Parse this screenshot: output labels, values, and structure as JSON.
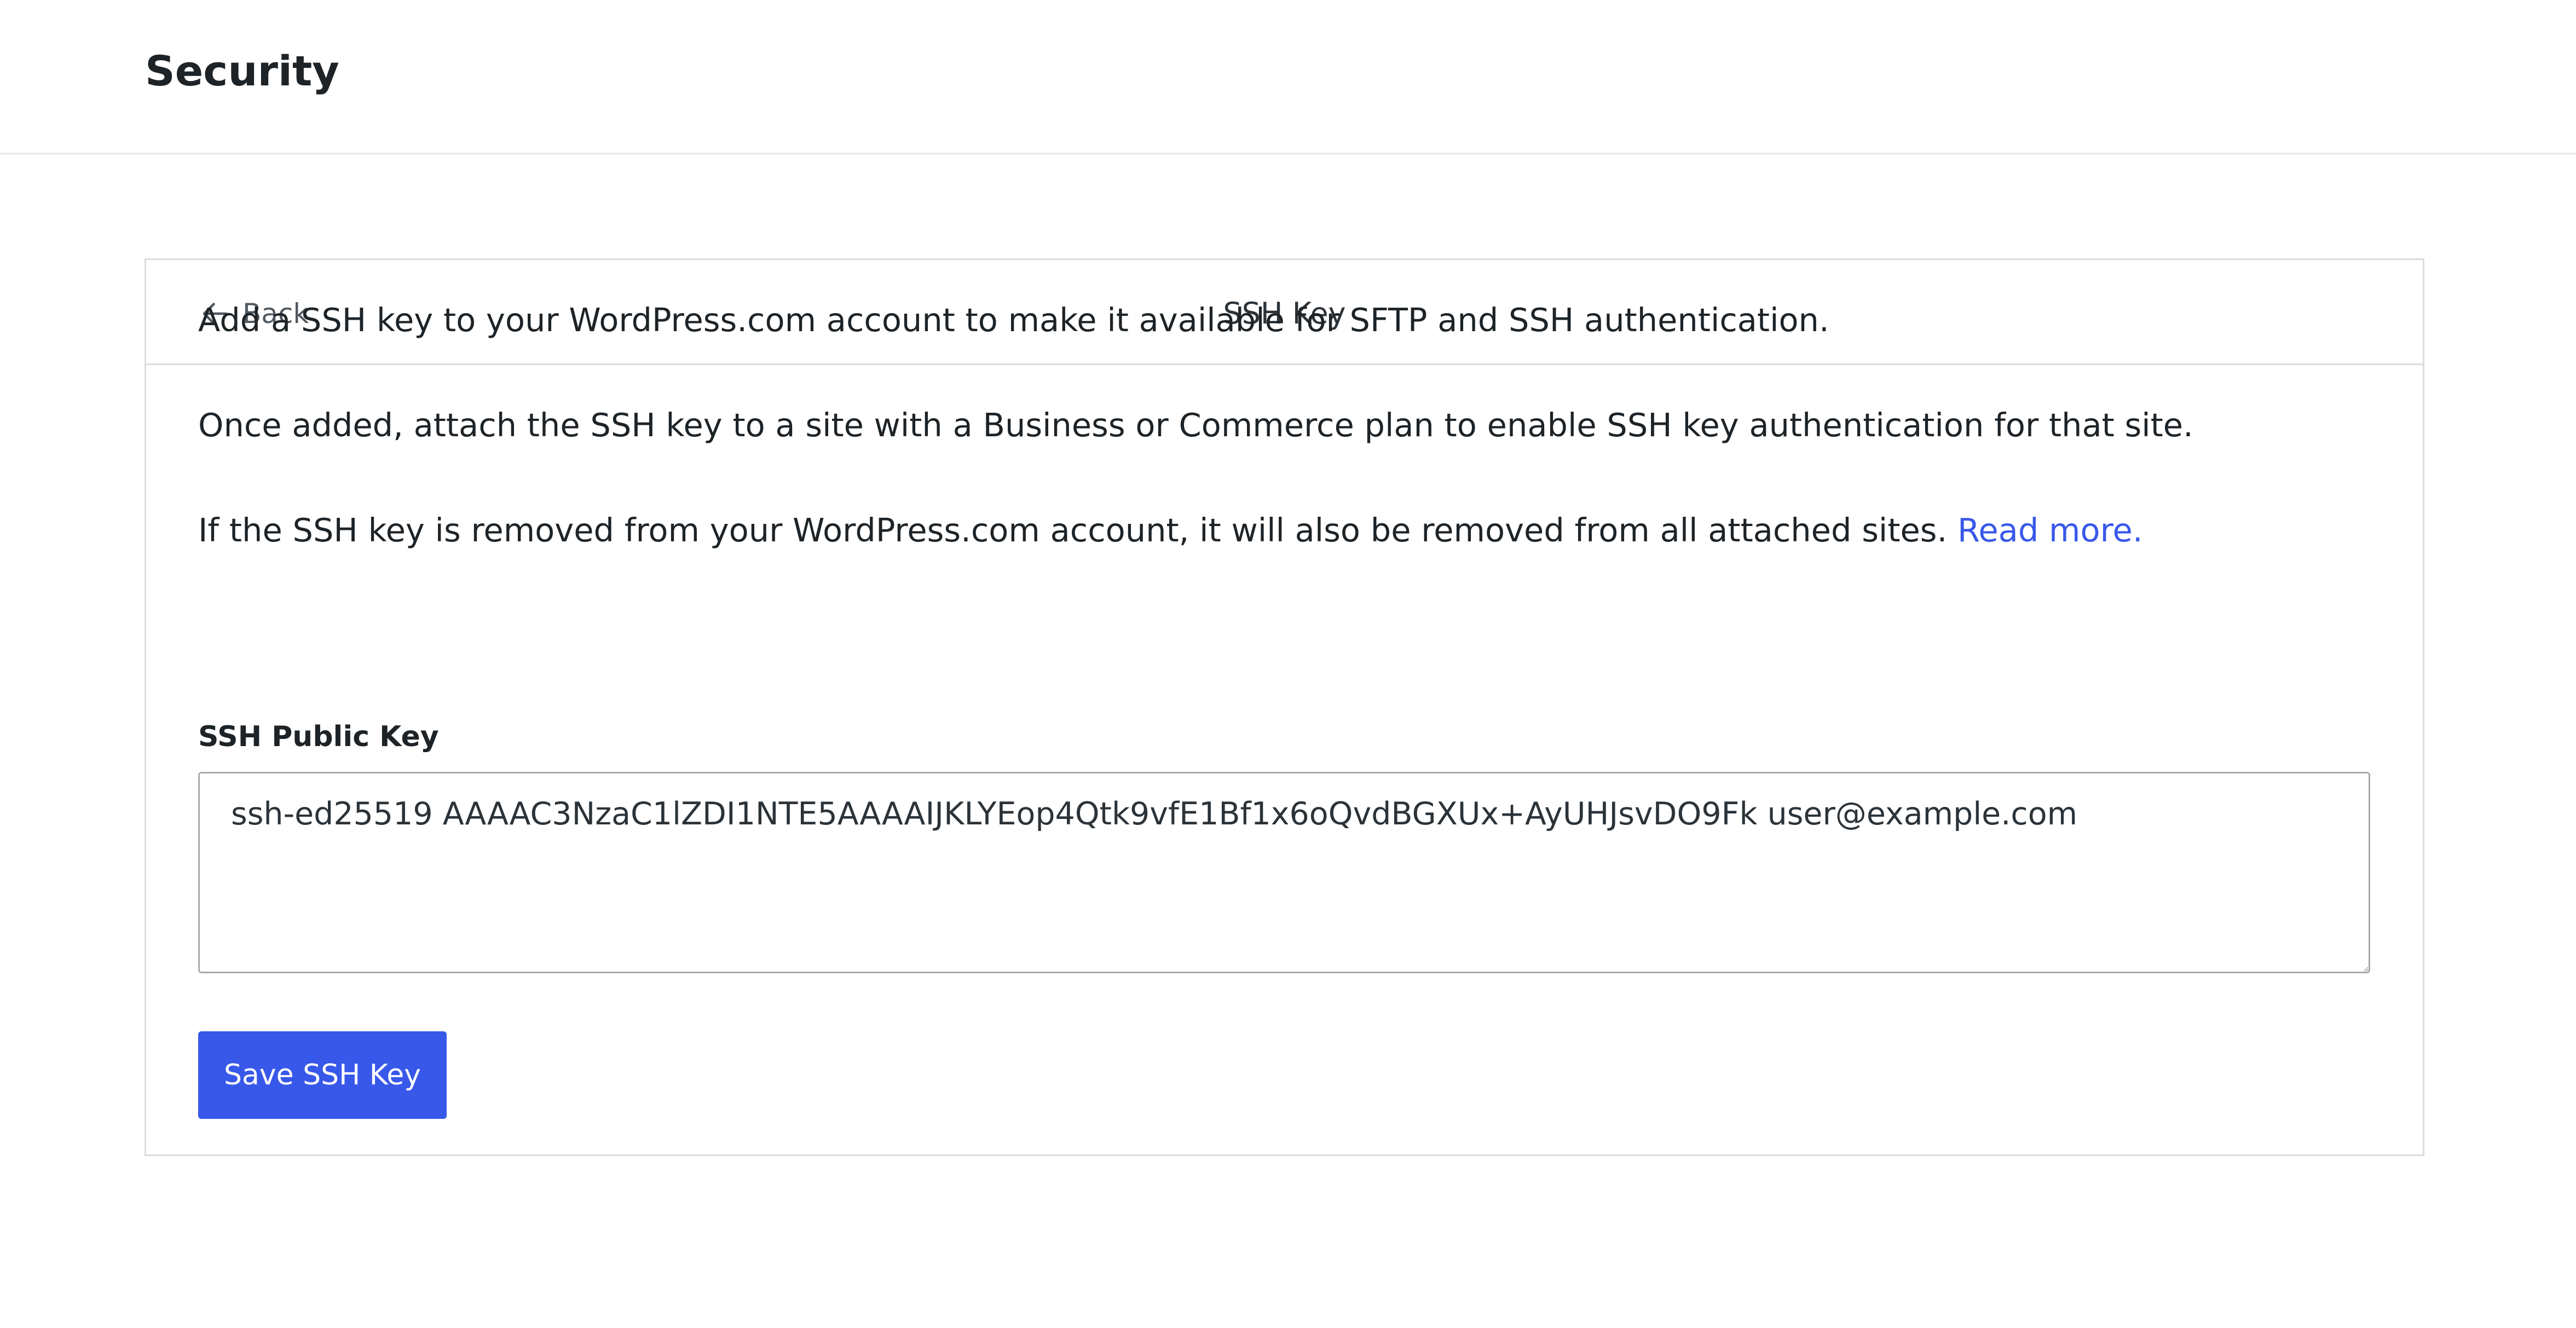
{
  "header": {
    "title": "Security"
  },
  "card": {
    "back_label": "Back",
    "title": "SSH Key"
  },
  "content": {
    "paragraph_1": "Add a SSH key to your WordPress.com account to make it available for SFTP and SSH authentication.",
    "paragraph_2": "Once added, attach the SSH key to a site with a Business or Commerce plan to enable SSH key authentication for that site.",
    "paragraph_3": "If the SSH key is removed from your WordPress.com account, it will also be removed from all attached sites.",
    "read_more_link": "Read more."
  },
  "form": {
    "label": "SSH Public Key",
    "value": "ssh-ed25519 AAAAC3NzaC1lZDI1NTE5AAAAIJKLYEop4Qtk9vfE1Bf1x6oQvdBGXUx+AyUHJsvDO9Fk user@example.com",
    "save_label": "Save SSH Key"
  },
  "icons": {
    "back": "arrow-left-icon"
  },
  "colors": {
    "accent": "#3858e9",
    "text": "#1d2327",
    "border": "#dcdcde",
    "input_border": "#a7aaad"
  }
}
